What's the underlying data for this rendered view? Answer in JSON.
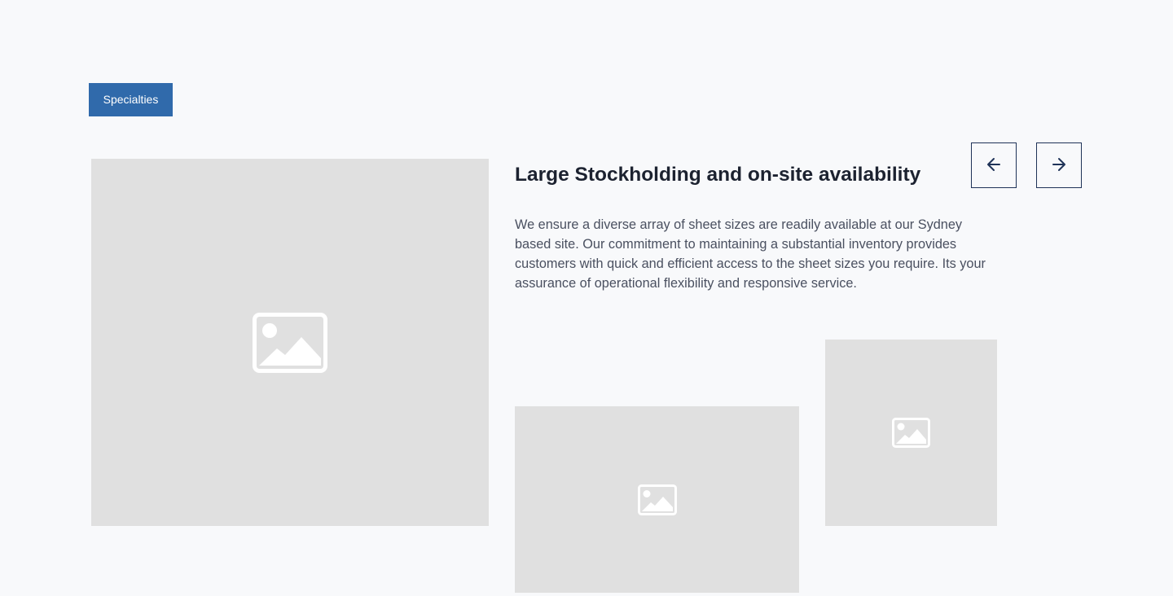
{
  "tag": {
    "label": "Specialties"
  },
  "content": {
    "title": "Large Stockholding and on-site availability",
    "description": "We ensure a diverse array of sheet sizes are readily available at our Sydney based site. Our commitment to maintaining a substantial inventory provides customers with quick and efficient access to the sheet sizes you require. Its your assurance of operational flexibility and responsive service."
  },
  "navigation": {
    "prev_icon": "arrow-left-icon",
    "next_icon": "arrow-right-icon"
  },
  "images": [
    {
      "name": "main-image",
      "icon": "image-placeholder-icon"
    },
    {
      "name": "secondary-image",
      "icon": "image-placeholder-icon"
    },
    {
      "name": "tertiary-image",
      "icon": "image-placeholder-icon"
    }
  ],
  "colors": {
    "background": "#f8f9fb",
    "accent": "#306aab",
    "placeholder": "#e0e0e0",
    "heading": "#1c2230",
    "body_text": "#4a5060",
    "nav_border": "#1f3358"
  }
}
